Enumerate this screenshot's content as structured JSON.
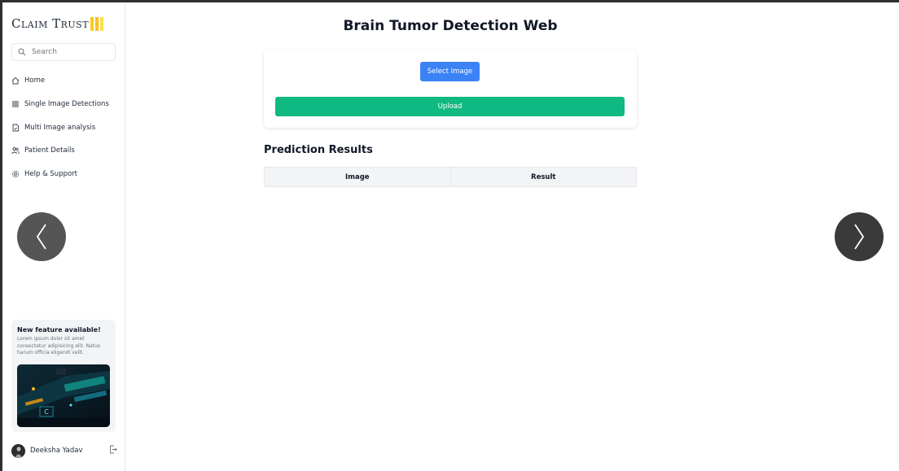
{
  "brand": {
    "name": "Claim Trust"
  },
  "search": {
    "placeholder": "Search"
  },
  "nav": {
    "items": [
      {
        "label": "Home",
        "icon": "home-icon"
      },
      {
        "label": "Single Image Detections",
        "icon": "list-icon"
      },
      {
        "label": "Multi Image analysis",
        "icon": "document-icon"
      },
      {
        "label": "Patient Details",
        "icon": "users-icon"
      },
      {
        "label": "Help & Support",
        "icon": "gear-icon"
      }
    ]
  },
  "feature": {
    "title": "New feature available!",
    "text": "Lorem ipsum dolor sit amet consectetur adipisicing elit. Natus harum officia eligendi velit."
  },
  "user": {
    "name": "Deeksha Yadav"
  },
  "main": {
    "title": "Brain Tumor Detection Web",
    "select_label": "Select Image",
    "upload_label": "Upload",
    "results_title": "Prediction Results",
    "table": {
      "columns": [
        "Image",
        "Result"
      ],
      "rows": []
    }
  },
  "carousel": {
    "prev_glyph": "‹",
    "next_glyph": "›"
  },
  "colors": {
    "primary": "#3b82f6",
    "success": "#10b981",
    "accent": "#facc15"
  }
}
